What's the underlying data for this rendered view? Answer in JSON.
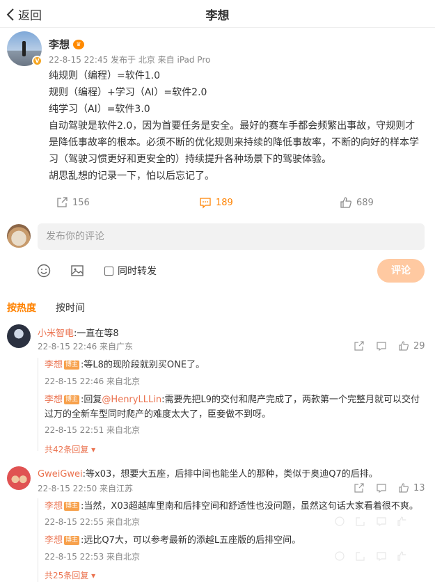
{
  "header": {
    "back_label": "返回",
    "title": "李想"
  },
  "post": {
    "author": "李想",
    "crown_icon": "crown-badge",
    "meta": "22-8-15 22:45  发布于 北京  来自 iPad Pro",
    "lines": [
      "纯规则（编程）=软件1.0",
      "规则（编程）+学习（AI）=软件2.0",
      "纯学习（AI）=软件3.0",
      "自动驾驶是软件2.0，因为首要任务是安全。最好的赛车手都会频繁出事故，守规则才是降低事故率的根本。必须不断的优化规则来持续的降低事故率，不断的向好的样本学习（驾驶习惯更好和更安全的）持续提升各种场景下的驾驶体验。",
      "胡思乱想的记录一下，怕以后忘记了。"
    ],
    "repost_count": "156",
    "comment_count": "189",
    "like_count": "689"
  },
  "composer": {
    "placeholder": "发布你的评论",
    "repost_label": "同时转发",
    "submit_label": "评论"
  },
  "sort": {
    "hot": "按热度",
    "time": "按时间"
  },
  "comments": [
    {
      "user": "小米智电",
      "text": ":一直在等8",
      "time": "22-8-15 22:46 来自广东",
      "likes": "29",
      "replies": [
        {
          "user": "李想",
          "badge": "博主",
          "text": ":等L8的现阶段就别买ONE了。",
          "time": "22-8-15 22:46 来自北京"
        },
        {
          "user": "李想",
          "badge": "博主",
          "prefix": ":回复",
          "mention": "@HenryLLLin",
          "text": ":需要先把L9的交付和爬产完成了，两款第一个完整月就可以交付过万的全新车型同时爬产的难度太大了，臣妾做不到呀。",
          "time": "22-8-15 22:51 来自北京"
        }
      ],
      "more": "共42条回复"
    },
    {
      "user": "GweiGwei",
      "text": ":等x03，想要大五座，后排中间也能坐人的那种，类似于奥迪Q7的后排。",
      "time": "22-8-15 22:50 来自江苏",
      "likes": "13",
      "replies": [
        {
          "user": "李想",
          "badge": "博主",
          "text": ":当然，X03超越库里南和后排空间和舒适性也没问题，虽然这句话大家看着很不爽。",
          "time": "22-8-15 22:55 来自北京"
        },
        {
          "user": "李想",
          "badge": "博主",
          "text": ":远比Q7大，可以参考最新的添越L五座版的后排空间。",
          "time": "22-8-15 22:53 来自北京"
        }
      ],
      "more": "共25条回复"
    }
  ],
  "colors": {
    "accent": "#ff8200",
    "username": "#eb7350",
    "submit_disabled": "#ffc9a1"
  }
}
